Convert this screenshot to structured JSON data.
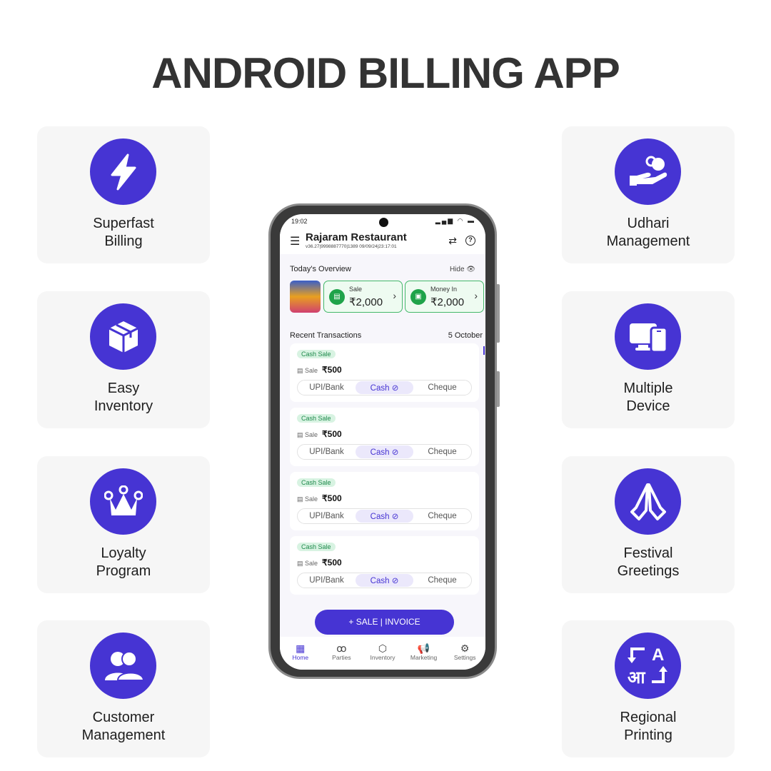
{
  "page_title": "ANDROID BILLING APP",
  "colors": {
    "accent": "#4634d3",
    "card_bg": "#f6f6f6",
    "green": "#1fa34a"
  },
  "features_left": [
    {
      "icon": "lightning-icon",
      "line1": "Superfast",
      "line2": "Billing"
    },
    {
      "icon": "package-icon",
      "line1": "Easy",
      "line2": "Inventory"
    },
    {
      "icon": "crown-icon",
      "line1": "Loyalty",
      "line2": "Program"
    },
    {
      "icon": "users-icon",
      "line1": "Customer",
      "line2": "Management"
    }
  ],
  "features_right": [
    {
      "icon": "hand-coin-icon",
      "line1": "Udhari",
      "line2": "Management"
    },
    {
      "icon": "devices-icon",
      "line1": "Multiple",
      "line2": "Device"
    },
    {
      "icon": "folded-hands-icon",
      "line1": "Festival",
      "line2": "Greetings"
    },
    {
      "icon": "translate-icon",
      "line1": "Regional",
      "line2": "Printing"
    }
  ],
  "phone": {
    "status_time": "19:02",
    "status_icons": "▂▄▆ ◠ ▬",
    "header": {
      "name": "Rajaram Restaurant",
      "meta": "v36.27|9998887770|1389  09/09/24|23:17:01",
      "menu": "☰",
      "sync": "⇄",
      "help": "?"
    },
    "overview": {
      "title": "Today's Overview",
      "hide_label": "Hide 👁",
      "cards": [
        {
          "label": "Sale",
          "value": "₹2,000",
          "icon": "▤"
        },
        {
          "label": "Money In",
          "value": "₹2,000",
          "icon": "▣"
        }
      ]
    },
    "recent": {
      "title": "Recent Transactions",
      "date": "5 October",
      "transactions": [
        {
          "badge": "Cash Sale",
          "type": "Sale",
          "amount": "₹500",
          "options": [
            "UPI/Bank",
            "Cash ⊘",
            "Cheque"
          ]
        },
        {
          "badge": "Cash Sale",
          "type": "Sale",
          "amount": "₹500",
          "options": [
            "UPI/Bank",
            "Cash ⊘",
            "Cheque"
          ]
        },
        {
          "badge": "Cash Sale",
          "type": "Sale",
          "amount": "₹500",
          "options": [
            "UPI/Bank",
            "Cash ⊘",
            "Cheque"
          ]
        },
        {
          "badge": "Cash Sale",
          "type": "Sale",
          "amount": "₹500",
          "options": [
            "UPI/Bank",
            "Cash ⊘",
            "Cheque"
          ]
        }
      ]
    },
    "fab_label": "+ SALE | INVOICE",
    "nav": [
      {
        "label": "Home",
        "glyph": "▦"
      },
      {
        "label": "Parties",
        "glyph": "ꝏ"
      },
      {
        "label": "Inventory",
        "glyph": "⬡"
      },
      {
        "label": "Marketing",
        "glyph": "📢"
      },
      {
        "label": "Settings",
        "glyph": "⚙"
      }
    ]
  }
}
